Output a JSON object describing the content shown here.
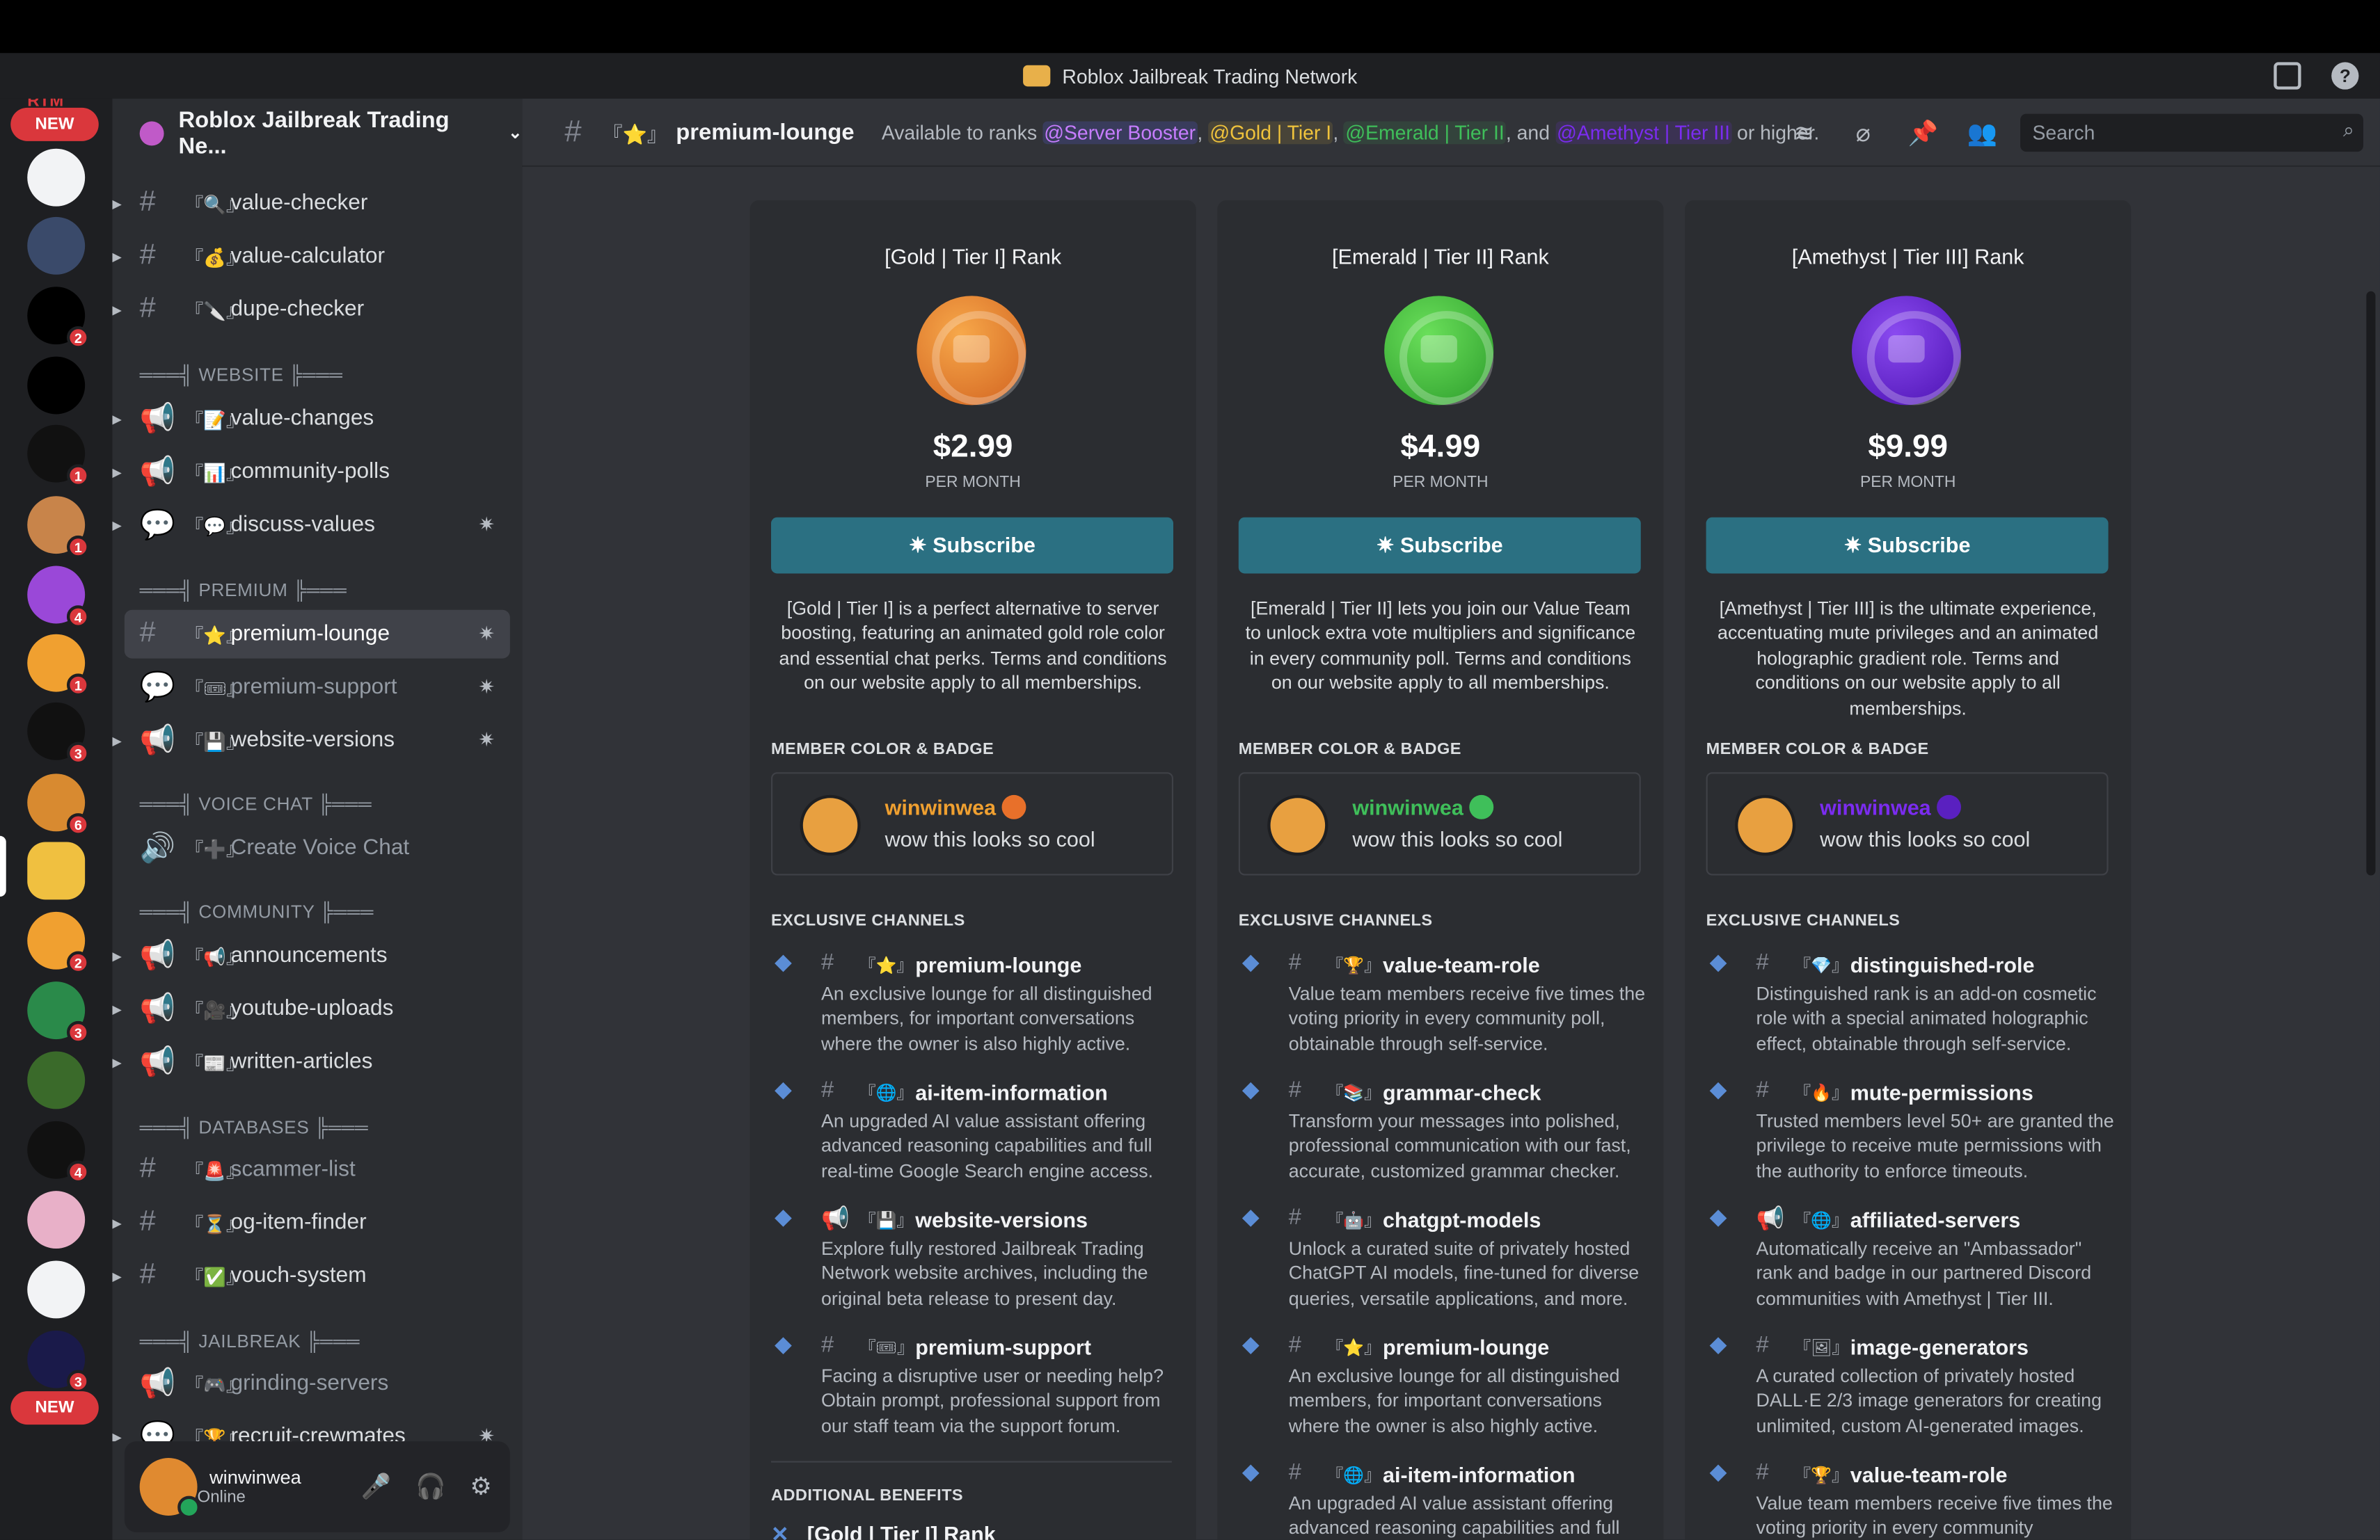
{
  "window": {
    "title": "Roblox Jailbreak Trading Network"
  },
  "rail": {
    "new_top": "NEW",
    "new_bottom": "NEW",
    "badges": [
      "2",
      "1",
      "1",
      "4",
      "1",
      "3",
      "6",
      "2",
      "3",
      "4",
      "3"
    ],
    "top_label": "RTM"
  },
  "sidebar": {
    "server_name": "Roblox Jailbreak Trading Ne...",
    "channels_top": [
      {
        "emoji": "『🔍』",
        "name": "value-checker"
      },
      {
        "emoji": "『💰』",
        "name": "value-calculator"
      },
      {
        "emoji": "『🔪』",
        "name": "dupe-checker"
      }
    ],
    "cat_website": "═══╣ WEBSITE ╠═══",
    "channels_website": [
      {
        "emoji": "『📝』",
        "name": "value-changes"
      },
      {
        "emoji": "『📊』",
        "name": "community-polls"
      },
      {
        "emoji": "『💬』",
        "name": "discuss-values"
      }
    ],
    "cat_premium": "═══╣ PREMIUM ╠═══",
    "channels_premium": [
      {
        "emoji": "『⭐』",
        "name": "premium-lounge"
      },
      {
        "emoji": "『🎟』",
        "name": "premium-support"
      },
      {
        "emoji": "『💾』",
        "name": "website-versions"
      }
    ],
    "cat_voice": "═══╣ VOICE CHAT ╠═══",
    "channels_voice": [
      {
        "emoji": "『➕』",
        "name": "Create Voice Chat"
      }
    ],
    "cat_community": "═══╣ COMMUNITY ╠═══",
    "channels_community": [
      {
        "emoji": "『📢』",
        "name": "announcements"
      },
      {
        "emoji": "『🎥』",
        "name": "youtube-uploads"
      },
      {
        "emoji": "『📰』",
        "name": "written-articles"
      }
    ],
    "cat_databases": "═══╣ DATABASES ╠═══",
    "channels_databases": [
      {
        "emoji": "『🚨』",
        "name": "scammer-list"
      },
      {
        "emoji": "『⏳』",
        "name": "og-item-finder"
      },
      {
        "emoji": "『✅』",
        "name": "vouch-system"
      }
    ],
    "cat_jailbreak": "═══╣ JAILBREAK ╠═══",
    "channels_jailbreak": [
      {
        "emoji": "『🎮』",
        "name": "grinding-servers"
      },
      {
        "emoji": "『🏆』",
        "name": "recruit-crewmates"
      }
    ],
    "user": {
      "name": "winwinwea",
      "status": "Online"
    }
  },
  "header": {
    "emoji": "『⭐』",
    "channel": "premium-lounge",
    "topic_pre": "Available to ranks",
    "mention1": "@Server Booster",
    "mention2": "@Gold | Tier I",
    "mention3": "@Emerald | Tier II",
    "mention4": "@Amethyst | Tier III",
    "sep": ",",
    "and": ", and",
    "topic_post": "or higher.",
    "search_placeholder": "Search"
  },
  "colors": {
    "gold": "#f0a030",
    "emerald": "#3fbf5a",
    "amethyst": "#7b2cf0",
    "subscribe": "#2b7082"
  },
  "cards": [
    {
      "title": "[Gold | Tier I] Rank",
      "price": "$2.99",
      "per": "PER MONTH",
      "button": "✷ Subscribe",
      "desc": "[Gold | Tier I] is a perfect alternative to server boosting, featuring an animated gold role color and essential chat perks. Terms and conditions on our website apply to all memberships.",
      "member_color_label": "MEMBER COLOR & BADGE",
      "preview_name": "winwinwea",
      "preview_msg": "wow this looks so cool",
      "exclusive_label": "EXCLUSIVE CHANNELS",
      "channels": [
        {
          "emoji": "『⭐』",
          "name": "premium-lounge",
          "desc": "An exclusive lounge for all distinguished members, for important conversations where the owner is also highly active."
        },
        {
          "emoji": "『🌐』",
          "name": "ai-item-information",
          "desc": "An upgraded AI value assistant offering advanced reasoning capabilities and full real-time Google Search engine access."
        },
        {
          "emoji": "『💾』",
          "name": "website-versions",
          "desc": "Explore fully restored Jailbreak Trading Network website archives, including the original beta release to present day."
        },
        {
          "emoji": "『🎟』",
          "name": "premium-support",
          "desc": "Facing a disruptive user or needing help? Obtain prompt, professional support from our staff team via the support forum."
        }
      ],
      "additional_label": "ADDITIONAL BENEFITS",
      "additional_item": "[Gold | Tier I] Rank"
    },
    {
      "title": "[Emerald | Tier II] Rank",
      "price": "$4.99",
      "per": "PER MONTH",
      "button": "✷ Subscribe",
      "desc": "[Emerald | Tier II] lets you join our Value Team to unlock extra vote multipliers and significance in every community poll. Terms and conditions on our website apply to all memberships.",
      "member_color_label": "MEMBER COLOR & BADGE",
      "preview_name": "winwinwea",
      "preview_msg": "wow this looks so cool",
      "exclusive_label": "EXCLUSIVE CHANNELS",
      "channels": [
        {
          "emoji": "『🏆』",
          "name": "value-team-role",
          "desc": "Value team members receive five times the voting priority in every community poll, obtainable through self-service."
        },
        {
          "emoji": "『📚』",
          "name": "grammar-check",
          "desc": "Transform your messages into polished, professional communication with our fast, accurate, customized grammar checker."
        },
        {
          "emoji": "『🤖』",
          "name": "chatgpt-models",
          "desc": "Unlock a curated suite of privately hosted ChatGPT AI models, fine-tuned for diverse queries, versatile applications, and more."
        },
        {
          "emoji": "『⭐』",
          "name": "premium-lounge",
          "desc": "An exclusive lounge for all distinguished members, for important conversations where the owner is also highly active."
        },
        {
          "emoji": "『🌐』",
          "name": "ai-item-information",
          "desc": "An upgraded AI value assistant offering advanced reasoning capabilities and full"
        }
      ]
    },
    {
      "title": "[Amethyst | Tier III] Rank",
      "price": "$9.99",
      "per": "PER MONTH",
      "button": "✷ Subscribe",
      "desc": "[Amethyst | Tier III] is the ultimate experience, accentuating mute privileges and an animated holographic gradient role. Terms and conditions on our website apply to all memberships.",
      "member_color_label": "MEMBER COLOR & BADGE",
      "preview_name": "winwinwea",
      "preview_msg": "wow this looks so cool",
      "exclusive_label": "EXCLUSIVE CHANNELS",
      "channels": [
        {
          "emoji": "『💎』",
          "name": "distinguished-role",
          "desc": "Distinguished rank is an add-on cosmetic role with a special animated holographic effect, obtainable through self-service."
        },
        {
          "emoji": "『🔥』",
          "name": "mute-permissions",
          "desc": "Trusted members level 50+ are granted the privilege to receive mute permissions with the authority to enforce timeouts."
        },
        {
          "emoji": "『🌐』",
          "name": "affiliated-servers",
          "desc": "Automatically receive an \"Ambassador\" rank and badge in our partnered Discord communities with Amethyst | Tier III."
        },
        {
          "emoji": "『🖼』",
          "name": "image-generators",
          "desc": "A curated collection of privately hosted DALL·E 2/3 image generators for creating unlimited, custom AI-generated images."
        },
        {
          "emoji": "『🏆』",
          "name": "value-team-role",
          "desc": "Value team members receive five times the voting priority in every community"
        }
      ]
    }
  ]
}
